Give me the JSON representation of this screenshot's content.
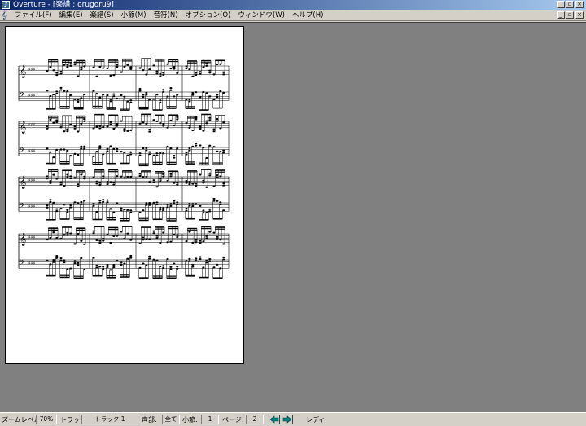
{
  "window": {
    "title": "Overture - [楽譜 : orugoru9]",
    "app_icon": "overture-icon",
    "min_glyph": "_",
    "max_glyph": "▫",
    "close_glyph": "×"
  },
  "menubar": {
    "doc_icon": "score-document-icon",
    "items": [
      {
        "label": "ファイル(F)"
      },
      {
        "label": "編集(E)"
      },
      {
        "label": "楽譜(S)"
      },
      {
        "label": "小節(M)"
      },
      {
        "label": "音符(N)"
      },
      {
        "label": "オプション(O)"
      },
      {
        "label": "ウィンドウ(W)"
      },
      {
        "label": "ヘルプ(H)"
      }
    ]
  },
  "score": {
    "clef_treble": "𝄞",
    "clef_bass": "𝄢",
    "key_signature": "♯♯♯",
    "systems": 4,
    "measures_per_system": 4
  },
  "statusbar": {
    "zoom_label": "ズームレベル:",
    "zoom_value": "70%",
    "track_label": "トラック:",
    "track_value": "トラック 1",
    "voice_label": "声部:",
    "voice_value": "全て",
    "measure_label": "小節:",
    "measure_value": "1",
    "page_label": "ページ:",
    "page_value": "2",
    "prev_icon": "prev-page-arrow-icon",
    "next_icon": "next-page-arrow-icon",
    "ready_text": "レディ",
    "arrow_color": "#008080"
  }
}
